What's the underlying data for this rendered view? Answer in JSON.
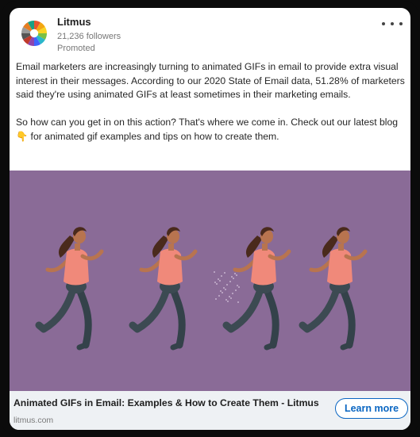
{
  "post": {
    "company_name": "Litmus",
    "followers": "21,236 followers",
    "promoted": "Promoted",
    "menu_icon": "more-horizontal-icon",
    "paragraph1": "Email marketers are increasingly turning to animated GIFs in email to provide extra visual interest in their messages. According to our 2020 State of Email data, 51.28% of marketers said they're using animated GIFs at least sometimes in their marketing emails.",
    "paragraph2": "So how can you get in on this action? That's where we come in. Check out our latest blog 👇 for animated gif examples and tips on how to create them."
  },
  "link_card": {
    "title": "Animated GIFs in Email: Examples & How to Create Them - Litmus",
    "domain": "litmus.com",
    "cta_label": "Learn more",
    "cta_color": "#0a66c2"
  },
  "colors": {
    "media_background": "#8a6b97",
    "link_bar_background": "#eef1f4",
    "shirt": "#f0897a",
    "pants": "#3c4a52",
    "skin": "#b8744f",
    "hair": "#4a2a1c"
  }
}
